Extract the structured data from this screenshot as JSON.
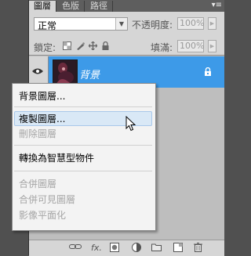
{
  "tabs": [
    {
      "label": "圖層",
      "active": true
    },
    {
      "label": "色版",
      "active": false
    },
    {
      "label": "路徑",
      "active": false
    }
  ],
  "panel_menu_glyph": "▾≡",
  "blend_mode": "正常",
  "opacity_label": "不透明度:",
  "opacity_value": "100%",
  "lock_label": "鎖定:",
  "fill_label": "填滿:",
  "fill_value": "100%",
  "layer": {
    "name": "背景",
    "selected": true,
    "visible": true,
    "locked": true
  },
  "context_menu": {
    "items": [
      {
        "label": "背景圖層...",
        "enabled": true
      },
      {
        "label": "複製圖層...",
        "enabled": true,
        "highlighted": true
      },
      {
        "label": "刪除圖層",
        "enabled": false
      },
      {
        "label": "轉換為智慧型物件",
        "enabled": true
      },
      {
        "label": "合併圖層",
        "enabled": false
      },
      {
        "label": "合併可見圖層",
        "enabled": false
      },
      {
        "label": "影像平面化",
        "enabled": false
      }
    ]
  },
  "bottom_icons": [
    "link-icon",
    "fx-icon",
    "mask-icon",
    "adjustment-icon",
    "folder-icon",
    "new-layer-icon",
    "trash-icon"
  ],
  "bottom_labels": {
    "fx": "fx."
  },
  "colors": {
    "selection": "#3d9ae8",
    "panel": "#d6d6d6",
    "menu_highlight": "#d9e8f6"
  }
}
